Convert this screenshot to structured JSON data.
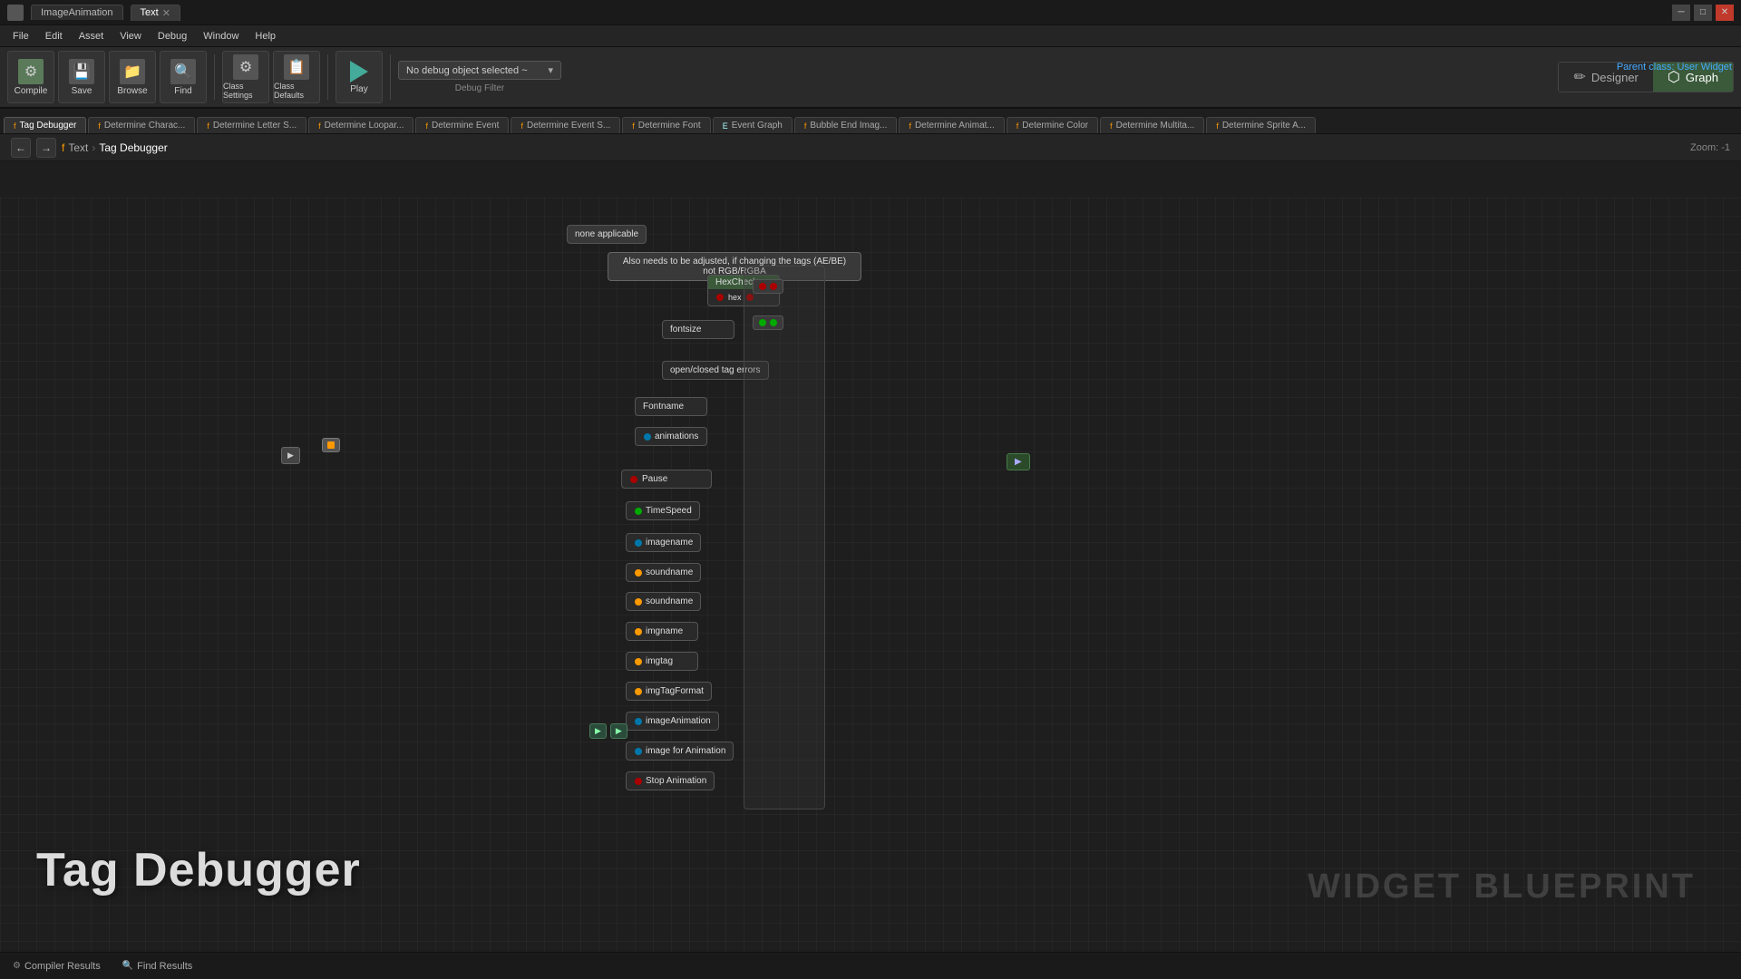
{
  "titleBar": {
    "appName": "ImageAnimation",
    "tabs": [
      {
        "label": "ImageAnimation",
        "active": false
      },
      {
        "label": "Text",
        "active": true
      }
    ],
    "controls": [
      "─",
      "□",
      "✕"
    ]
  },
  "menuBar": {
    "items": [
      "File",
      "Edit",
      "Asset",
      "View",
      "Debug",
      "Window",
      "Help"
    ]
  },
  "toolbar": {
    "buttons": [
      {
        "label": "Compile",
        "icon": "⚙"
      },
      {
        "label": "Save",
        "icon": "💾"
      },
      {
        "label": "Browse",
        "icon": "📁"
      },
      {
        "label": "Find",
        "icon": "🔍"
      },
      {
        "label": "Class Settings",
        "icon": "⚙"
      },
      {
        "label": "Class Defaults",
        "icon": "📋"
      },
      {
        "label": "Play",
        "icon": "▶"
      }
    ],
    "debugFilter": {
      "label": "Debug Filter",
      "value": "No debug object selected ~",
      "placeholder": "No debug object selected ~"
    }
  },
  "viewToggle": {
    "designer": "Designer",
    "graph": "Graph",
    "activeView": "graph"
  },
  "parentClass": {
    "label": "Parent class:",
    "value": "User Widget"
  },
  "tabs": [
    {
      "label": "Tag Debugger",
      "active": true,
      "icon": "f"
    },
    {
      "label": "Determine Charac...",
      "active": false,
      "icon": "f"
    },
    {
      "label": "Determine Letter S...",
      "active": false,
      "icon": "f"
    },
    {
      "label": "Determine Loopar...",
      "active": false,
      "icon": "f"
    },
    {
      "label": "Determine Event",
      "active": false,
      "icon": "f"
    },
    {
      "label": "Determine Event S...",
      "active": false,
      "icon": "f"
    },
    {
      "label": "Determine Font",
      "active": false,
      "icon": "f"
    },
    {
      "label": "Event Graph",
      "active": false,
      "icon": "E"
    },
    {
      "label": "Bubble End Imag...",
      "active": false,
      "icon": "f"
    },
    {
      "label": "Determine Animat...",
      "active": false,
      "icon": "f"
    },
    {
      "label": "Determine Color",
      "active": false,
      "icon": "f"
    },
    {
      "label": "Determine Multita...",
      "active": false,
      "icon": "f"
    },
    {
      "label": "Determine Sprite A...",
      "active": false,
      "icon": "f"
    }
  ],
  "breadcrumb": {
    "navBack": "←",
    "navForward": "→",
    "path": [
      {
        "label": "f Text",
        "separator": "›"
      },
      {
        "label": "Tag Debugger"
      }
    ],
    "zoom": "Zoom: -1"
  },
  "canvas": {
    "tagDebuggerLabel": "Tag Debugger",
    "widgetBlueprintLabel": "WIDGET BLUEPRINT"
  },
  "nodes": {
    "commentBubble": "Also needs to be adjusted, if changing the tags (AE/BE)\nnot RGB/RGBA",
    "noneApplicable": "none applicable",
    "hexCheck": "HexCheck",
    "fontsize": "fontsize",
    "openClosedTagErrors": "open/closed tag errors",
    "fontname": "Fontname",
    "animations": "animations",
    "pause": "Pause",
    "timeSpeed": "TimeSpeed",
    "imageName": "imagename",
    "soundname1": "soundname",
    "soundname2": "soundname",
    "imgName": "imgname",
    "imgTag": "imgtag",
    "imgTagFormat": "imgTagFormat",
    "imageAnimation": "imageAnimation",
    "imageForAnimation": "image for Animation",
    "stopAnimation": "Stop Animation"
  },
  "statusBar": {
    "tabs": [
      {
        "label": "Compiler Results",
        "icon": "⚙",
        "active": false
      },
      {
        "label": "Find Results",
        "icon": "🔍",
        "active": false
      }
    ]
  }
}
